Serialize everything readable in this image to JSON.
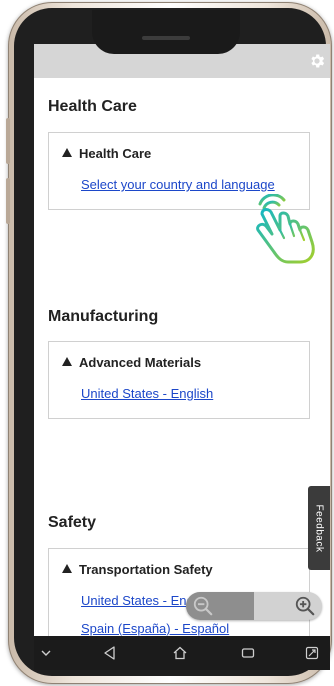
{
  "screen": {
    "settings_icon": "gear-icon",
    "sections": [
      {
        "title": "Health Care",
        "card": {
          "heading": "Health Care",
          "links": [
            "Select your country and language"
          ]
        }
      },
      {
        "title": "Manufacturing",
        "card": {
          "heading": "Advanced Materials",
          "links": [
            "United States - English"
          ]
        }
      },
      {
        "title": "Safety",
        "card": {
          "heading": "Transportation Safety",
          "links": [
            "United States - English",
            "Spain (España) - Español"
          ]
        }
      }
    ],
    "feedback_label": "Feedback",
    "zoom": {
      "out_icon": "zoom-out-icon",
      "in_icon": "zoom-in-icon"
    }
  },
  "nav_bar": {
    "icons": [
      "chevron-down-icon",
      "back-icon",
      "home-icon",
      "recents-icon",
      "rotate-icon"
    ]
  },
  "colors": {
    "link": "#1c47c9",
    "top_bar": "#d6d6d6",
    "bezel": "#1f1f1f",
    "hand_gradient_start": "#0fb6c9",
    "hand_gradient_end": "#a4cf2a"
  }
}
